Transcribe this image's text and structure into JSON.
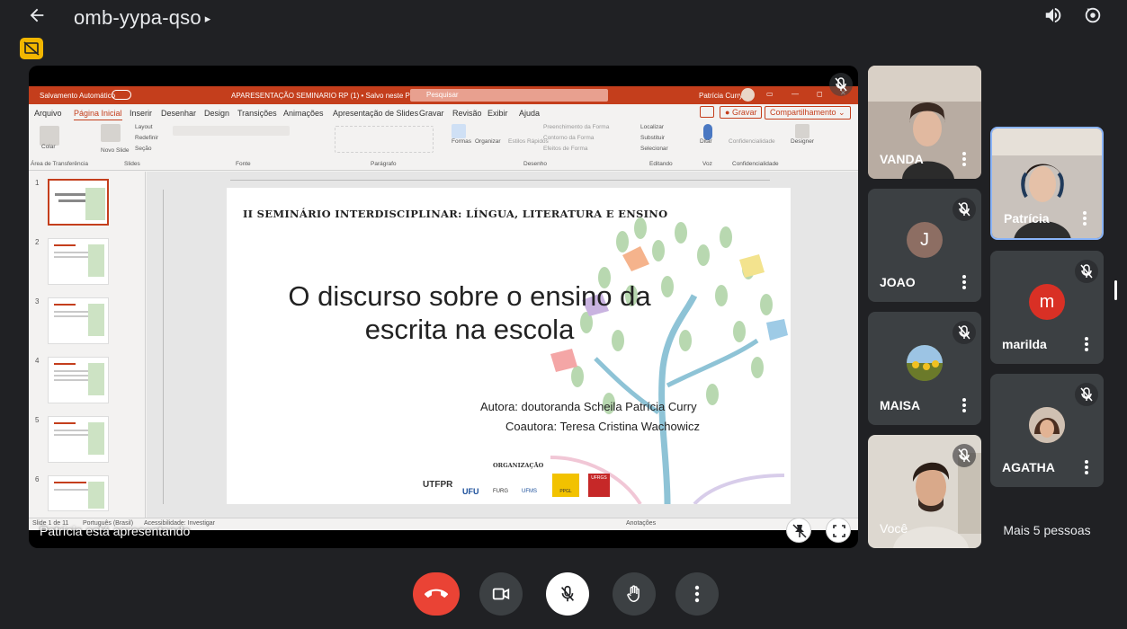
{
  "meeting": {
    "code": "omb-yypa-qso"
  },
  "presentation": {
    "presenting_label": "Patrícia está apresentando",
    "app": {
      "autosave": "Salvamento Automático",
      "doc_title": "APARESENTAÇÃO SEMINARIO RP (1) • Salvo neste PC ⌄",
      "search_placeholder": "Pesquisar",
      "user": "Patrícia Curry",
      "menu": [
        "Arquivo",
        "Página Inicial",
        "Inserir",
        "Desenhar",
        "Design",
        "Transições",
        "Animações",
        "Apresentação de Slides",
        "Gravar",
        "Revisão",
        "Exibir",
        "Ajuda"
      ],
      "record_button": "Gravar",
      "share_button": "Compartilhamento",
      "ribbon_groups": [
        "Área de Transferência",
        "Slides",
        "Fonte",
        "Parágrafo",
        "Desenho",
        "Editando",
        "Voz",
        "Confidencialidade"
      ],
      "ribbon_labels": {
        "paste": "Colar",
        "new_slide": "Novo Slide",
        "layout": "Layout",
        "reset": "Redefinir",
        "section": "Seção",
        "shapes": "Formas",
        "arrange": "Organizar",
        "quick_styles": "Estilos Rápidos",
        "fill": "Preenchimento da Forma",
        "outline": "Contorno da Forma",
        "effects": "Efeitos de Forma",
        "find": "Localizar",
        "replace": "Substituir",
        "select": "Selecionar",
        "dictate": "Ditar",
        "sensitivity": "Confidencialidade",
        "designer": "Designer"
      },
      "status": {
        "slide_info": "Slide 1 de 11",
        "language": "Português (Brasil)",
        "accessibility": "Acessibilidade: Investigar",
        "notes": "Anotações"
      },
      "thumb_numbers": [
        "1",
        "2",
        "3",
        "4",
        "5",
        "6"
      ]
    },
    "slide": {
      "header": "II SEMINÁRIO INTERDISCIPLINAR: LÍNGUA, LITERATURA E ENSINO",
      "title": "O discurso sobre o ensino da escrita na escola",
      "author": "Autora: doutoranda Scheila Patrícia Curry",
      "coauthor": "Coautora: Teresa Cristina Wachowicz",
      "org_label": "ORGANIZAÇÃO",
      "logos": [
        "UTFPR",
        "UFU",
        "FURG",
        "UFMS",
        "PPGL",
        "UFRGS"
      ]
    }
  },
  "participants": [
    {
      "name": "VANDA",
      "muted": false
    },
    {
      "name": "Patrícia",
      "muted": false
    },
    {
      "name": "JOAO",
      "muted": true,
      "initial": "J",
      "avatar_color": "#8d6e63"
    },
    {
      "name": "marilda",
      "muted": true,
      "initial": "m",
      "avatar_color": "#d93025"
    },
    {
      "name": "MAISA",
      "muted": true
    },
    {
      "name": "AGATHA",
      "muted": true
    },
    {
      "name": "Você",
      "muted": true
    }
  ],
  "more_people": "Mais 5 pessoas",
  "colors": {
    "background": "#202124",
    "tile": "#3c4043",
    "leave": "#ea4335",
    "ppt_accent": "#c43e1c",
    "active_speaker": "#8ab4f8"
  },
  "icons": [
    "back-arrow-icon",
    "volume-icon",
    "switch-camera-icon",
    "mic-off-icon",
    "more-vert-icon",
    "fullscreen-icon",
    "call-end-icon",
    "camera-icon",
    "raise-hand-icon"
  ]
}
